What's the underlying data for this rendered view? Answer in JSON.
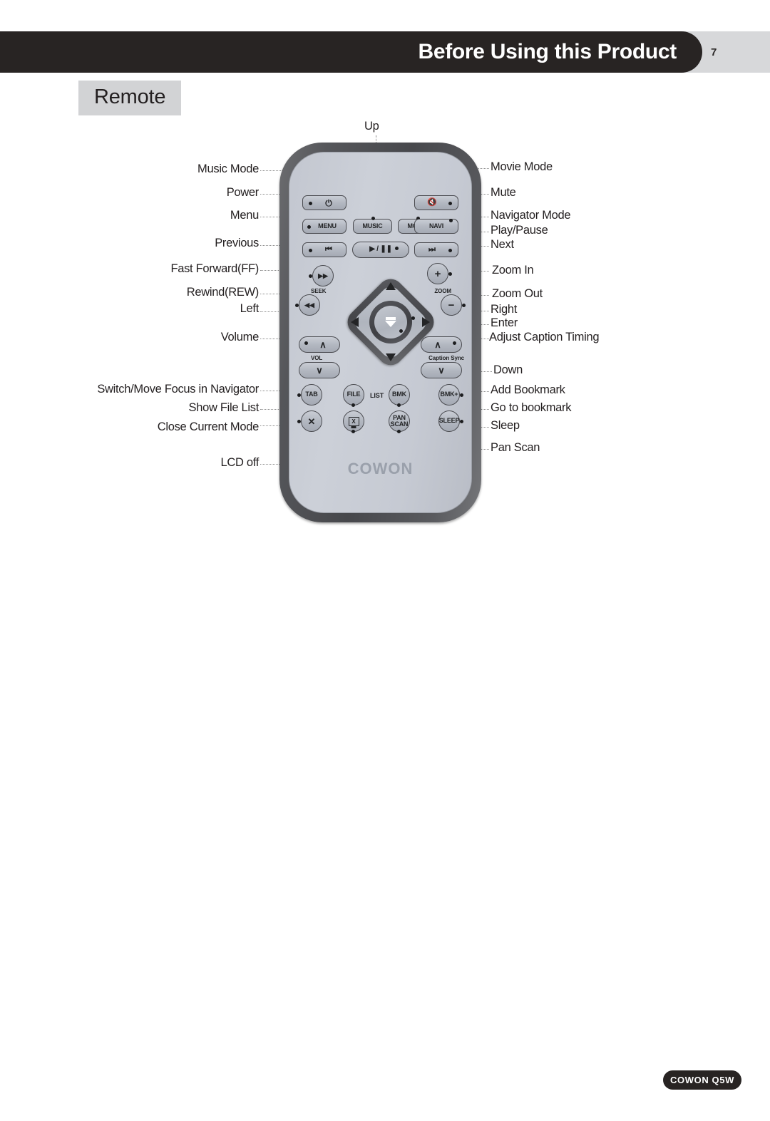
{
  "header": {
    "title": "Before Using this Product",
    "page_number": "7"
  },
  "section": {
    "title": "Remote"
  },
  "footer": {
    "badge": "COWON Q5W"
  },
  "remote": {
    "brand": "COWON",
    "group_labels": {
      "seek": "SEEK",
      "zoom": "ZOOM",
      "vol": "VOL",
      "caption_sync": "Caption Sync",
      "list": "LIST"
    },
    "buttons": {
      "power": "⏻",
      "mute": "🔇",
      "menu": "MENU",
      "music": "MUSIC",
      "movie": "MOVIE",
      "navi": "NAVI",
      "previous": "⏮",
      "play_pause": "▶ / ❚❚",
      "next": "⏭",
      "ff": "▶▶",
      "rew": "◀◀",
      "zoom_in": "+",
      "zoom_out": "−",
      "vol_up": "∧",
      "vol_down": "∨",
      "caption_up": "∧",
      "caption_down": "∨",
      "tab": "TAB",
      "file": "FILE",
      "bmk": "BMK",
      "bmk_plus": "BMK+",
      "close": "✕",
      "lcd_off": "X",
      "pan_scan": "PAN SCAN",
      "pan_scan_line1": "PAN",
      "pan_scan_line2": "SCAN",
      "sleep": "SLEEP"
    }
  },
  "callouts": {
    "top": "Up",
    "left": [
      "Music Mode",
      "Power",
      "Menu",
      "Previous",
      "Fast Forward(FF)",
      "Rewind(REW)",
      "Left",
      "Volume",
      "Switch/Move Focus in Navigator",
      "Show File List",
      "Close Current Mode",
      "LCD off"
    ],
    "right": [
      "Movie Mode",
      "Mute",
      "Navigator Mode",
      "Play/Pause",
      "Next",
      "Zoom In",
      "Zoom Out",
      "Right",
      "Enter",
      "Adjust Caption Timing",
      "Down",
      "Add Bookmark",
      "Go to bookmark",
      "Sleep",
      "Pan Scan"
    ]
  }
}
